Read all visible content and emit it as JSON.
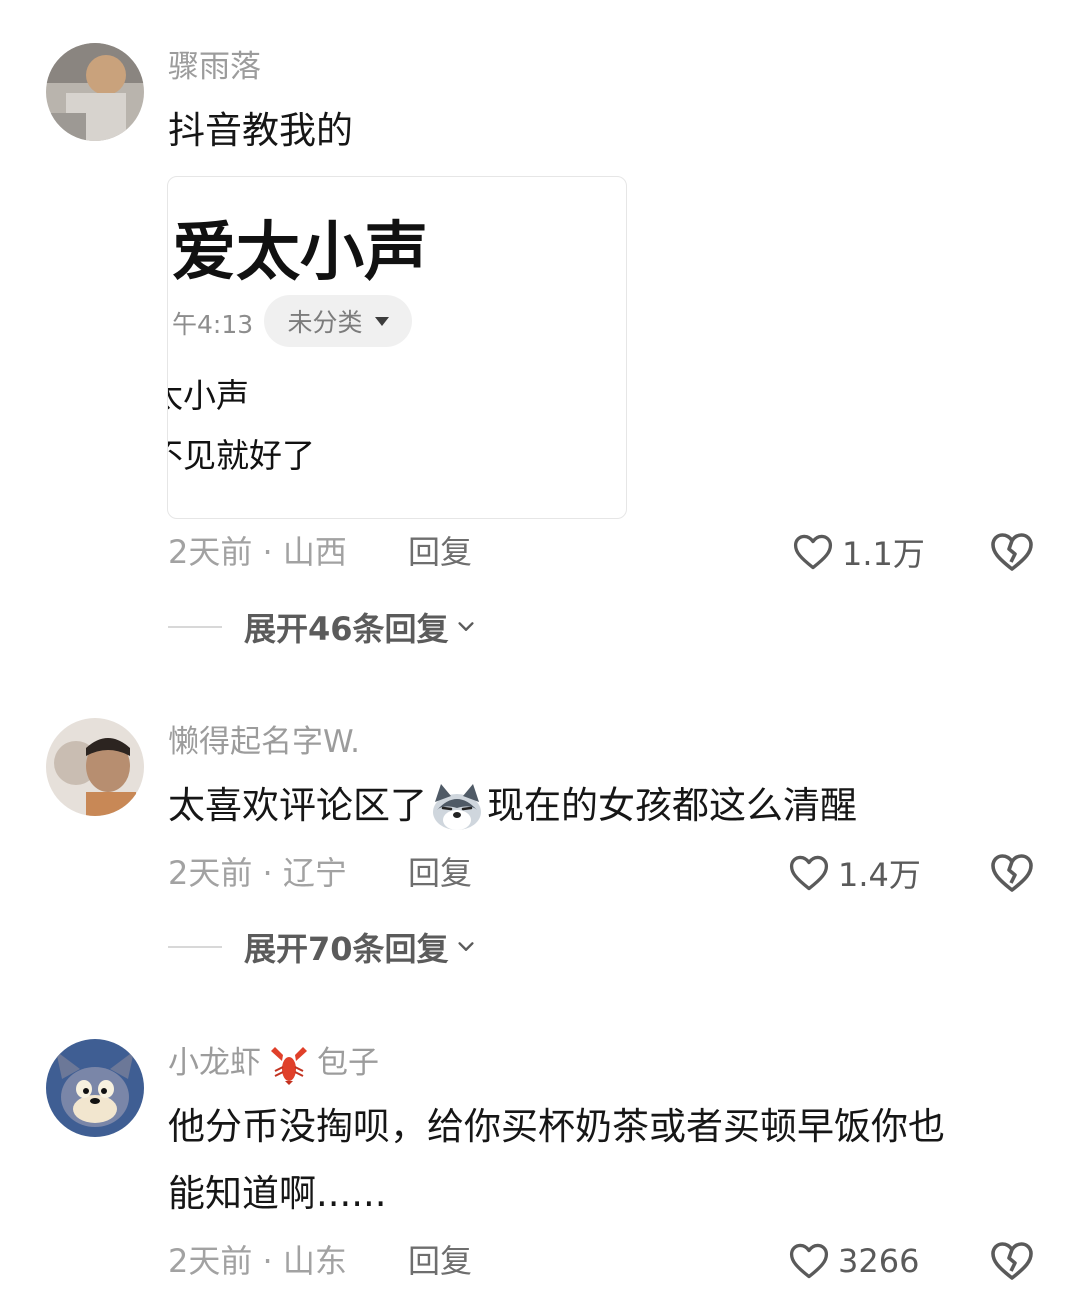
{
  "comments": [
    {
      "username": "骤雨落",
      "text": "抖音教我的",
      "attached_image": {
        "title": "爱太小声",
        "time": "午4:13",
        "tag": "未分类",
        "lines": [
          "太小声",
          "不见就好了"
        ]
      },
      "meta": "2天前 · 山西",
      "reply_label": "回复",
      "likes": "1.1万",
      "expand_label": "展开46条回复"
    },
    {
      "username": "懒得起名字W.",
      "text_before": "太喜欢评论区了",
      "emoji": "husky-emoji",
      "text_after": "现在的女孩都这么清醒",
      "meta": "2天前 · 辽宁",
      "reply_label": "回复",
      "likes": "1.4万",
      "expand_label": "展开70条回复"
    },
    {
      "username_part1": "小龙虾",
      "username_emoji": "lobster-emoji",
      "username_part2": "包子",
      "text_line1": "他分币没掏呗，给你买杯奶茶或者买顿早饭你也",
      "text_line2": "能知道啊......",
      "meta": "2天前 · 山东",
      "reply_label": "回复",
      "likes": "3266"
    }
  ],
  "icons": {
    "like": "heart-outline-icon",
    "dislike": "broken-heart-icon",
    "expand": "chevron-down-icon"
  },
  "colors": {
    "username": "#9c9c9c",
    "text": "#161616",
    "meta": "#a2a2a2"
  }
}
